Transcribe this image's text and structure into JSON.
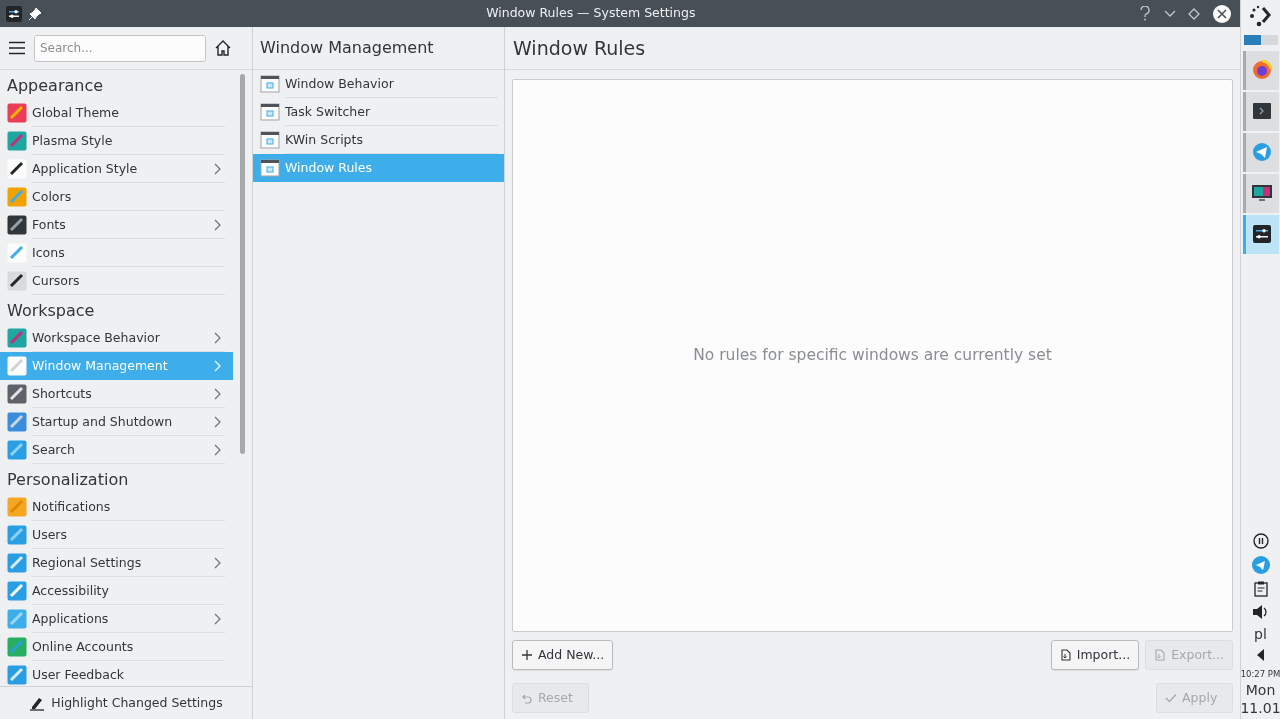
{
  "window": {
    "title": "Window Rules — System Settings"
  },
  "sidebar": {
    "search": {
      "placeholder": "Search..."
    },
    "groups": [
      {
        "title": "Appearance",
        "items": [
          {
            "label": "Global Theme",
            "has_subpages": false,
            "selected": false
          },
          {
            "label": "Plasma Style",
            "has_subpages": false,
            "selected": false
          },
          {
            "label": "Application Style",
            "has_subpages": true,
            "selected": false
          },
          {
            "label": "Colors",
            "has_subpages": false,
            "selected": false
          },
          {
            "label": "Fonts",
            "has_subpages": true,
            "selected": false
          },
          {
            "label": "Icons",
            "has_subpages": false,
            "selected": false
          },
          {
            "label": "Cursors",
            "has_subpages": false,
            "selected": false
          }
        ]
      },
      {
        "title": "Workspace",
        "items": [
          {
            "label": "Workspace Behavior",
            "has_subpages": true,
            "selected": false
          },
          {
            "label": "Window Management",
            "has_subpages": true,
            "selected": true
          },
          {
            "label": "Shortcuts",
            "has_subpages": true,
            "selected": false
          },
          {
            "label": "Startup and Shutdown",
            "has_subpages": true,
            "selected": false
          },
          {
            "label": "Search",
            "has_subpages": true,
            "selected": false
          }
        ]
      },
      {
        "title": "Personalization",
        "items": [
          {
            "label": "Notifications",
            "has_subpages": false,
            "selected": false
          },
          {
            "label": "Users",
            "has_subpages": false,
            "selected": false
          },
          {
            "label": "Regional Settings",
            "has_subpages": true,
            "selected": false
          },
          {
            "label": "Accessibility",
            "has_subpages": false,
            "selected": false
          },
          {
            "label": "Applications",
            "has_subpages": true,
            "selected": false
          },
          {
            "label": "Online Accounts",
            "has_subpages": false,
            "selected": false
          },
          {
            "label": "User Feedback",
            "has_subpages": false,
            "selected": false
          }
        ]
      }
    ],
    "footer_button": "Highlight Changed Settings"
  },
  "subpanel": {
    "title": "Window Management",
    "items": [
      {
        "label": "Window Behavior",
        "selected": false
      },
      {
        "label": "Task Switcher",
        "selected": false
      },
      {
        "label": "KWin Scripts",
        "selected": false
      },
      {
        "label": "Window Rules",
        "selected": true
      }
    ]
  },
  "main": {
    "title": "Window Rules",
    "empty_message": "No rules for specific windows are currently set",
    "add_button": {
      "label": "Add New...",
      "disabled": false
    },
    "import_button": {
      "label": "Import...",
      "disabled": false
    },
    "export_button": {
      "label": "Export...",
      "disabled": true
    },
    "reset_button": {
      "label": "Reset",
      "disabled": true
    },
    "apply_button": {
      "label": "Apply",
      "disabled": true
    }
  },
  "panel": {
    "tasks": [
      {
        "active": false
      },
      {
        "active": false
      },
      {
        "active": false
      },
      {
        "active": false
      },
      {
        "active": true
      }
    ],
    "keyboard_layout": "pl",
    "clock": {
      "time": "10:27 PM",
      "day": "Mon",
      "date": "11.01"
    }
  }
}
